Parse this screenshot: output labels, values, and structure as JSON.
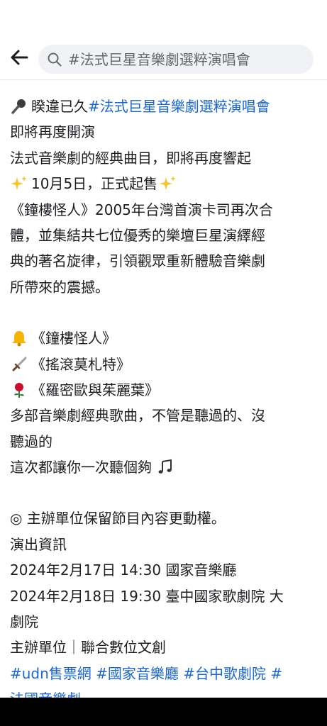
{
  "search": {
    "placeholder": "#法式巨星音樂劇選粹演唱會"
  },
  "post": {
    "l1_text": "睽違已久 ",
    "l1_tag": "#法式巨星音樂劇選粹演唱會",
    "l2": "即將再度開演",
    "l3": "法式音樂劇的經典曲目，即將再度響起",
    "l4": "10月5日，正式起售",
    "l5": "《鐘樓怪人》2005年台灣首演卡司再次合",
    "l6": "體，並集結共七位優秀的樂壇巨星演繹經",
    "l7": "典的著名旋律，引領觀眾重新體驗音樂劇",
    "l8": "所帶來的震撼。",
    "show1": "《鐘樓怪人》",
    "show2": "《搖滾莫札特》",
    "show3": "《羅密歐與茱麗葉》",
    "l12": "多部音樂劇經典歌曲，不管是聽過的、沒",
    "l13": "聽過的",
    "l14": "這次都讓你一次聽個夠",
    "l15": "◎ 主辦單位保留節目內容更動權。",
    "l16": "演出資訊",
    "l17": "2024年2月17日 14:30 國家音樂廳",
    "l18": "2024年2月18日 19:30 臺中國家歌劇院 大",
    "l19": "劇院",
    "l20": "主辦單位｜聯合數位文創",
    "tag_udn": "#udn售票網",
    "tag_ntch": "#國家音樂廳",
    "tag_taichung": "#台中歌劇院",
    "tag_hash": "#",
    "tag_french": "法國音樂劇"
  },
  "icons": {
    "mic": "microphone-icon",
    "sparkles": "sparkles-icon",
    "bell": "bell-icon",
    "dagger": "dagger-icon",
    "rose": "rose-icon",
    "notes": "music-notes-icon"
  },
  "colors": {
    "link": "#1a66d6",
    "text": "#1c1e21",
    "search_bg": "#f0f2f5"
  }
}
